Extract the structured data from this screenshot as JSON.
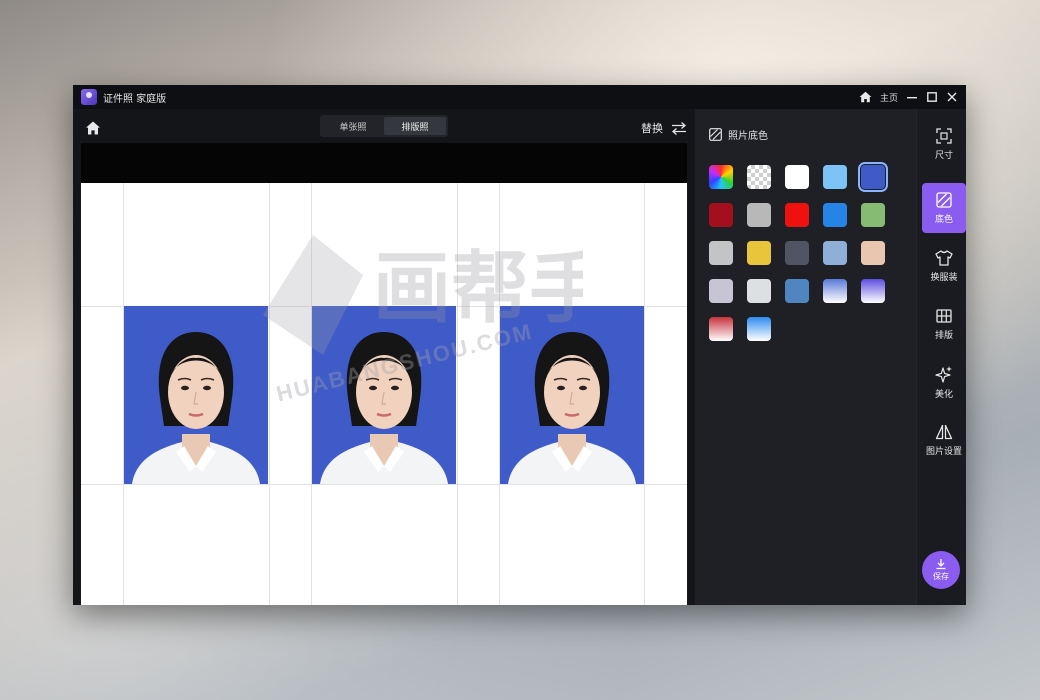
{
  "window": {
    "app_title": "证件照 家庭版",
    "home_label": "主页"
  },
  "toolbar": {
    "tabs": [
      {
        "label": "单张照",
        "active": false
      },
      {
        "label": "排版照",
        "active": true
      }
    ],
    "replace_label": "替换"
  },
  "watermark": {
    "cn": "画帮手",
    "en": "HUABANGSHOU.COM"
  },
  "panel": {
    "title": "照片底色",
    "swatches": [
      {
        "name": "rainbow",
        "css": "conic-gradient(#ff2a2a, #ffd400, #2fd13a, #22c6ff, #2f43ff, #c02cff, #ff2a2a)"
      },
      {
        "name": "transparent",
        "css": "repeating-conic-gradient(#cfcfcf 0% 25%, #ffffff 0% 50%) 0 0 / 8px 8px"
      },
      {
        "name": "white",
        "css": "#ffffff"
      },
      {
        "name": "light-blue",
        "css": "#7cc4f5"
      },
      {
        "name": "blue",
        "css": "#3f5bc8",
        "selected": true
      },
      {
        "name": "dark-red",
        "css": "#a30f1c"
      },
      {
        "name": "gray",
        "css": "#b8b8b8"
      },
      {
        "name": "red",
        "css": "#ef1010"
      },
      {
        "name": "sky-blue",
        "css": "#2584e6"
      },
      {
        "name": "green",
        "css": "#86bb73"
      },
      {
        "name": "light-gray",
        "css": "#c2c4c6"
      },
      {
        "name": "yellow",
        "css": "#e8c53a"
      },
      {
        "name": "slate",
        "css": "#505463"
      },
      {
        "name": "powder-blue",
        "css": "#8fb0d6"
      },
      {
        "name": "peach",
        "css": "#e9c6b0"
      },
      {
        "name": "lavender-gray",
        "css": "#c7c5d3"
      },
      {
        "name": "pale-gray",
        "css": "#dde0e2"
      },
      {
        "name": "steel-blue",
        "css": "#4f86c0"
      },
      {
        "name": "blue-white-gradient",
        "css": "linear-gradient(#5a79d8, #ffffff)"
      },
      {
        "name": "indigo-white-gradient",
        "css": "linear-gradient(#5d4de0, #ffffff)"
      },
      {
        "name": "red-white-gradient",
        "css": "linear-gradient(#c8323c, #ffffff)"
      },
      {
        "name": "azure-white-gradient",
        "css": "linear-gradient(#2f8cf0, #ffffff)"
      }
    ]
  },
  "side_nav": {
    "items": [
      {
        "label": "尺寸",
        "icon": "crop-frame-icon",
        "active": false
      },
      {
        "label": "底色",
        "icon": "hatch-square-icon",
        "active": true
      },
      {
        "label": "换服装",
        "icon": "shirt-icon",
        "active": false
      },
      {
        "label": "排版",
        "icon": "grid-layout-icon",
        "active": false
      },
      {
        "label": "美化",
        "icon": "sparkle-icon",
        "active": false
      },
      {
        "label": "图片设置",
        "icon": "mirror-flip-icon",
        "active": false
      }
    ],
    "save_label": "保存"
  },
  "colors": {
    "accent": "#8a5cf0",
    "photo_bg": "#3f5bc8",
    "window_bg": "#111215",
    "panel_bg": "#1e2026"
  }
}
